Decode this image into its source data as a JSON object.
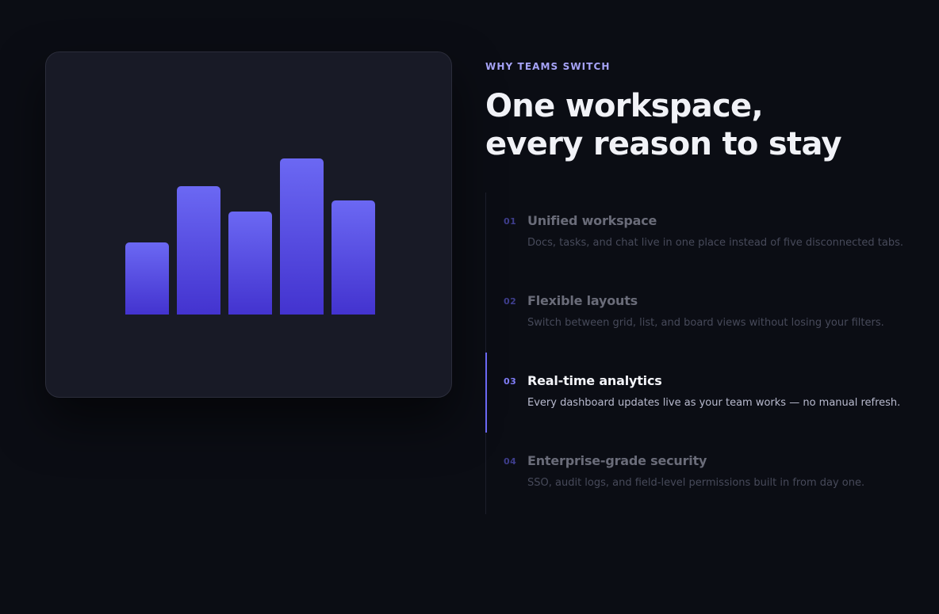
{
  "illustration": {
    "bar_levels": [
      0.46,
      0.82,
      0.66,
      1.0,
      0.73
    ],
    "gradient_top": "#6b68f3",
    "gradient_bottom": "#4333cf"
  },
  "section": {
    "eyebrow": "WHY TEAMS SWITCH",
    "headline_line1": "One workspace,",
    "headline_line2": "every reason to stay"
  },
  "features": [
    {
      "num": "01",
      "title": "Unified workspace",
      "desc": "Docs, tasks, and chat live in one place instead of five disconnected tabs."
    },
    {
      "num": "02",
      "title": "Flexible layouts",
      "desc": "Switch between grid, list, and board views without losing your filters."
    },
    {
      "num": "03",
      "title": "Real-time analytics",
      "desc": "Every dashboard updates live as your team works — no manual refresh."
    },
    {
      "num": "04",
      "title": "Enterprise-grade security",
      "desc": "SSO, audit logs, and field-level permissions built in from day one."
    }
  ],
  "active_feature": "03",
  "colors": {
    "background": "#0b0d14",
    "accent": "#6b68f3",
    "eyebrow": "#a6a3f7"
  }
}
